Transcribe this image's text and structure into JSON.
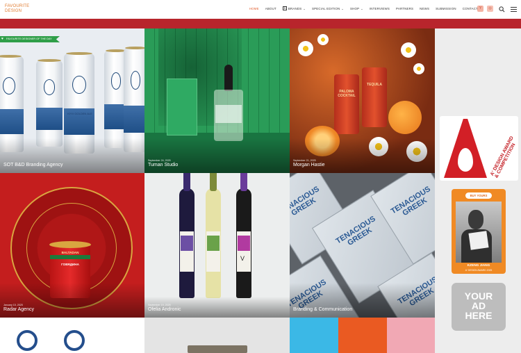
{
  "header": {
    "logo_line1": "FAVOURITE",
    "logo_line2": "DESIGN",
    "nav": [
      {
        "label": "HOME",
        "active": true
      },
      {
        "label": "ABOUT"
      },
      {
        "label": "BRANDS",
        "dropdown": true
      },
      {
        "label": "SPECIAL EDITION",
        "dropdown": true
      },
      {
        "label": "SHOP",
        "dropdown": true
      },
      {
        "label": "INTERVIEWS"
      },
      {
        "label": "PARTNERS"
      },
      {
        "label": "NEWS"
      },
      {
        "label": "SUBMISSION"
      },
      {
        "label": "CONTACT"
      }
    ],
    "social": [
      "Y",
      "◎"
    ]
  },
  "colors": {
    "accent_red": "#b8252c",
    "nav_active": "#e05a2a",
    "badge_green": "#2e9e48"
  },
  "badge": "FAVOURITE DESIGNER OF THE DAY",
  "tiles": [
    {
      "date": "",
      "name": "SOT B&D Branding Agency"
    },
    {
      "date": "September 24, 2025",
      "name": "Tuman Studio"
    },
    {
      "date": "September 21, 2025",
      "name": "Morgan Hastie"
    },
    {
      "date": "January 15, 2025",
      "name": "Radar Agency"
    },
    {
      "date": "September 19, 2025",
      "name": "Ofelia Andronic"
    },
    {
      "date": "",
      "name": "Branding & Communication"
    }
  ],
  "product_text": {
    "can_brand": "KIYV GOLDEN ALE",
    "cocktail_brand": "PALOMA COCKTAIL",
    "cocktail_sub": "TEQUILA",
    "tin_brand": "BALTADAN",
    "tin_title": "ГОВЯДИНА",
    "pack_brand": "TENACIOUS GREEK",
    "wine_letter": "V"
  },
  "sidebar": {
    "award_lines": [
      "A' DESIGN AWARD",
      "& COMPETITION"
    ],
    "buy_label": "BUY YOURS",
    "buy_name": "KZENG JIANG",
    "buy_year": "A' DESIGN AWARD 2025",
    "ad_lines": [
      "YOUR",
      "AD",
      "HERE"
    ]
  }
}
